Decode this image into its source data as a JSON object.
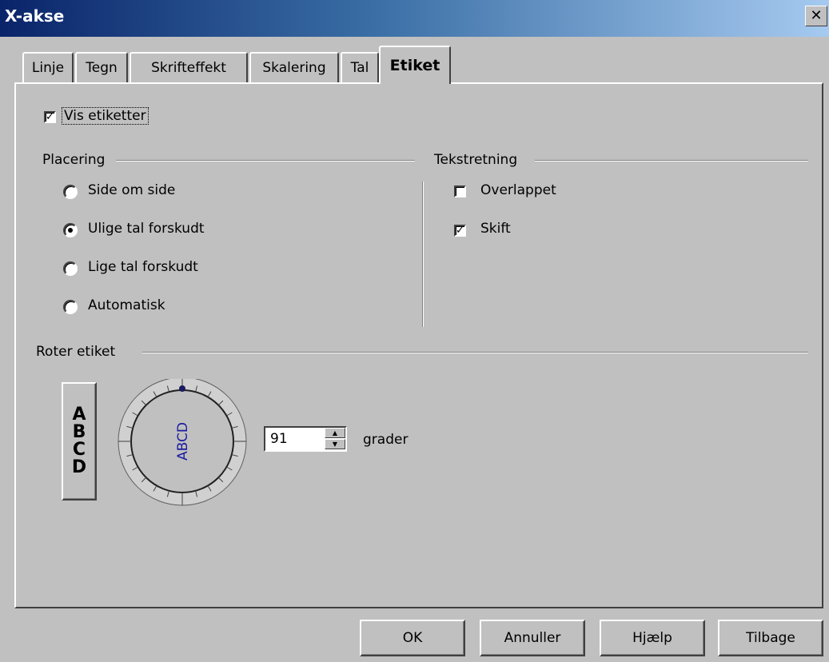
{
  "window": {
    "title": "X-akse",
    "close_glyph": "✕"
  },
  "tabs": [
    {
      "label": "Linje"
    },
    {
      "label": "Tegn"
    },
    {
      "label": "Skrifteffekt"
    },
    {
      "label": "Skalering"
    },
    {
      "label": "Tal"
    },
    {
      "label": "Etiket",
      "active": true
    }
  ],
  "show_labels": {
    "label": "Vis etiketter",
    "checked": true
  },
  "placement": {
    "title": "Placering",
    "options": [
      {
        "label": "Side om side",
        "checked": false
      },
      {
        "label": "Ulige tal forskudt",
        "checked": true
      },
      {
        "label": "Lige tal forskudt",
        "checked": false
      },
      {
        "label": "Automatisk",
        "checked": false
      }
    ]
  },
  "text_direction": {
    "title": "Tekstretning",
    "options": [
      {
        "label": "Overlappet",
        "checked": false
      },
      {
        "label": "Skift",
        "checked": true
      }
    ]
  },
  "rotate": {
    "title": "Roter etiket",
    "vertical_button_letters": [
      "A",
      "B",
      "C",
      "D"
    ],
    "dial_text": "ABCD",
    "degrees_value": "91",
    "degrees_unit": "grader"
  },
  "buttons": {
    "ok": "OK",
    "cancel": "Annuller",
    "help": "Hjælp",
    "back": "Tilbage"
  },
  "colors": {
    "dial_text": "#1a1aa0",
    "title_gradient_start": "#0a246a"
  }
}
